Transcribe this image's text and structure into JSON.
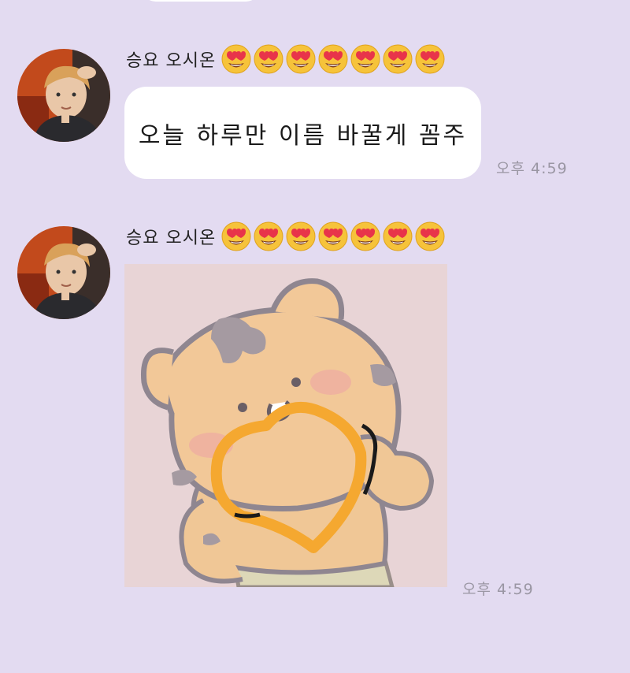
{
  "colors": {
    "background": "#e3dbf1",
    "bubble": "#ffffff",
    "time_text": "#9a96a3",
    "sticker_bg": "#e8d4d6",
    "heart_stroke": "#f5a830"
  },
  "messages": [
    {
      "sender_name": "승요 오시온",
      "sender_emojis": [
        "heart-eyes-emoji",
        "heart-eyes-emoji",
        "heart-eyes-emoji",
        "heart-eyes-emoji",
        "heart-eyes-emoji",
        "heart-eyes-emoji",
        "heart-eyes-emoji"
      ],
      "text": "오늘 하루만 이름 바꿀게 꼼주",
      "time": "오후 4:59"
    },
    {
      "sender_name": "승요 오시온",
      "sender_emojis": [
        "heart-eyes-emoji",
        "heart-eyes-emoji",
        "heart-eyes-emoji",
        "heart-eyes-emoji",
        "heart-eyes-emoji",
        "heart-eyes-emoji",
        "heart-eyes-emoji"
      ],
      "sticker": "tiger-heart-sticker",
      "time": "오후 4:59"
    }
  ]
}
